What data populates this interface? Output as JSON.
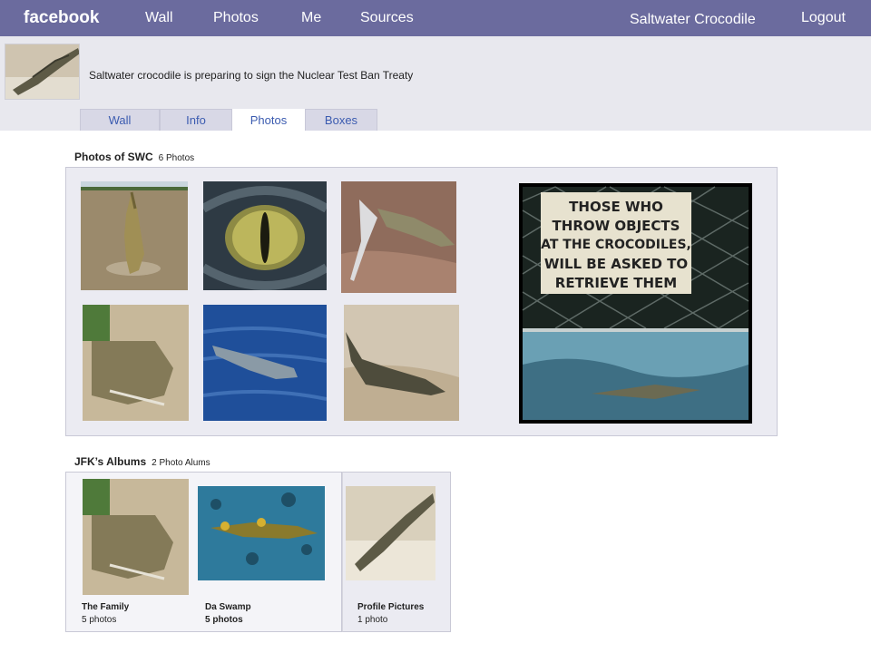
{
  "nav": {
    "logo": "facebook",
    "links": [
      "Wall",
      "Photos",
      "Me",
      "Sources"
    ],
    "user": "Saltwater Crocodile",
    "logout": "Logout"
  },
  "profile": {
    "status": "Saltwater crocodile is preparing to sign the Nuclear Test Ban Treaty"
  },
  "tabs": [
    "Wall",
    "Info",
    "Photos",
    "Boxes"
  ],
  "active_tab": "Photos",
  "photos_section": {
    "title": "Photos of SWC",
    "count": "6 Photos"
  },
  "sign_photo": {
    "lines": [
      "THOSE WHO",
      "THROW OBJECTS",
      "AT THE CROCODILES,",
      "WILL BE ASKED TO",
      "RETRIEVE THEM"
    ]
  },
  "albums_section": {
    "title": "JFK’s Albums",
    "count": "2 Photo Alums",
    "albums": [
      {
        "name": "The Family",
        "count": "5 photos"
      },
      {
        "name": "Da Swamp",
        "count": "5 photos"
      },
      {
        "name": "Profile Pictures",
        "count": "1 photo"
      }
    ]
  },
  "colors": {
    "topbar": "#6b6b9e",
    "header_bg": "#e8e8ee",
    "panel_bg": "#ebebf2",
    "tab_text": "#3b5bb0"
  }
}
